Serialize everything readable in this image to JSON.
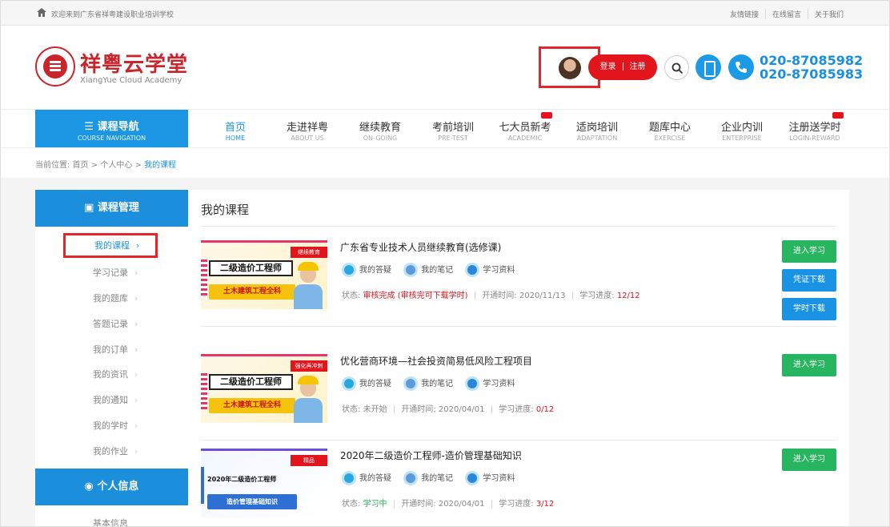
{
  "topbar": {
    "welcome": "欢迎来到广东省祥粤建设职业培训学校",
    "links": [
      "友情链接",
      "在线留言",
      "关于我们"
    ]
  },
  "header": {
    "logo_title": "祥粤云学堂",
    "logo_sub": "XiangYue Cloud Academy",
    "login": "登录",
    "register": "注册",
    "phone1": "020-87085982",
    "phone2": "020-87085983"
  },
  "nav": {
    "course_nav_title": "课程导航",
    "course_nav_sub": "COURSE NAVIGATION",
    "items": [
      {
        "cn": "首页",
        "en": "HOME"
      },
      {
        "cn": "走进祥粤",
        "en": "ABOUT US"
      },
      {
        "cn": "继续教育",
        "en": "ON-GOING"
      },
      {
        "cn": "考前培训",
        "en": "PRE-TEST"
      },
      {
        "cn": "七大员新考",
        "en": "ACADEMIC"
      },
      {
        "cn": "适岗培训",
        "en": "ADAPTATION"
      },
      {
        "cn": "题库中心",
        "en": "EXERCISE"
      },
      {
        "cn": "企业内训",
        "en": "ENTERPRISE"
      },
      {
        "cn": "注册送学时",
        "en": "LOGIN-REWARD"
      }
    ]
  },
  "breadcrumb": {
    "prefix": "当前位置:",
    "home": "首页",
    "center": "个人中心",
    "current": "我的课程",
    "sep": ">"
  },
  "sidebar": {
    "course_mgmt": "课程管理",
    "items": [
      "我的课程",
      "学习记录",
      "我的题库",
      "答题记录",
      "我的订单",
      "我的资讯",
      "我的通知",
      "我的学时",
      "我的作业"
    ],
    "personal": "个人信息",
    "personal_first": "基本信息"
  },
  "main": {
    "title": "我的课程",
    "link_labels": [
      "我的答疑",
      "我的笔记",
      "学习资料"
    ],
    "status_label": "状态:",
    "open_label": "开通时间:",
    "progress_label": "学习进度:",
    "courses": [
      {
        "title": "广东省专业技术人员继续教育(选修课)",
        "thumb_tag": "继续教育",
        "thumb_title": "二级造价工程师",
        "thumb_sub": "土木建筑工程全科",
        "status": "审核完成 (审核完可下载学时)",
        "open_date": "2020/11/13",
        "progress": "12/12",
        "buttons": [
          "进入学习",
          "凭证下载",
          "学时下载"
        ]
      },
      {
        "title": "优化营商环境—社会投资简易低风险工程项目",
        "thumb_tag": "强化再冲刺",
        "thumb_title": "二级造价工程师",
        "thumb_sub": "土木建筑工程全科",
        "status": "未开始",
        "open_date": "2020/04/01",
        "progress": "0/12",
        "buttons": [
          "进入学习"
        ]
      },
      {
        "title": "2020年二级造价工程师-造价管理基础知识",
        "thumb_tag": "精品",
        "thumb_title": "2020年二级造价工程师",
        "thumb_sub": "造价管理基础知识",
        "status": "学习中",
        "open_date": "2020/04/01",
        "progress": "3/12",
        "buttons": [
          "进入学习"
        ]
      }
    ]
  },
  "colors": {
    "accent": "#1b96e3",
    "red": "#e2141c",
    "green": "#27b560"
  }
}
